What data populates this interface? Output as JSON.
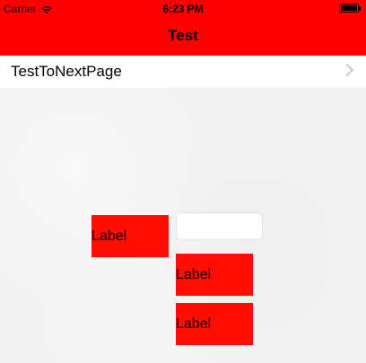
{
  "status_bar": {
    "carrier": "Carrier",
    "time": "6:23 PM",
    "wifi_icon": "wifi-icon",
    "battery_icon": "battery-icon"
  },
  "nav": {
    "title": "Test",
    "background_color": "#ff0000"
  },
  "list": {
    "items": [
      {
        "label": "TestToNextPage",
        "accessory_icon": "chevron-right-icon"
      }
    ]
  },
  "content": {
    "labels": [
      "Label",
      "Label",
      "Label"
    ],
    "text_field": {
      "value": "",
      "placeholder": ""
    },
    "label_color": "#ff0d00"
  }
}
